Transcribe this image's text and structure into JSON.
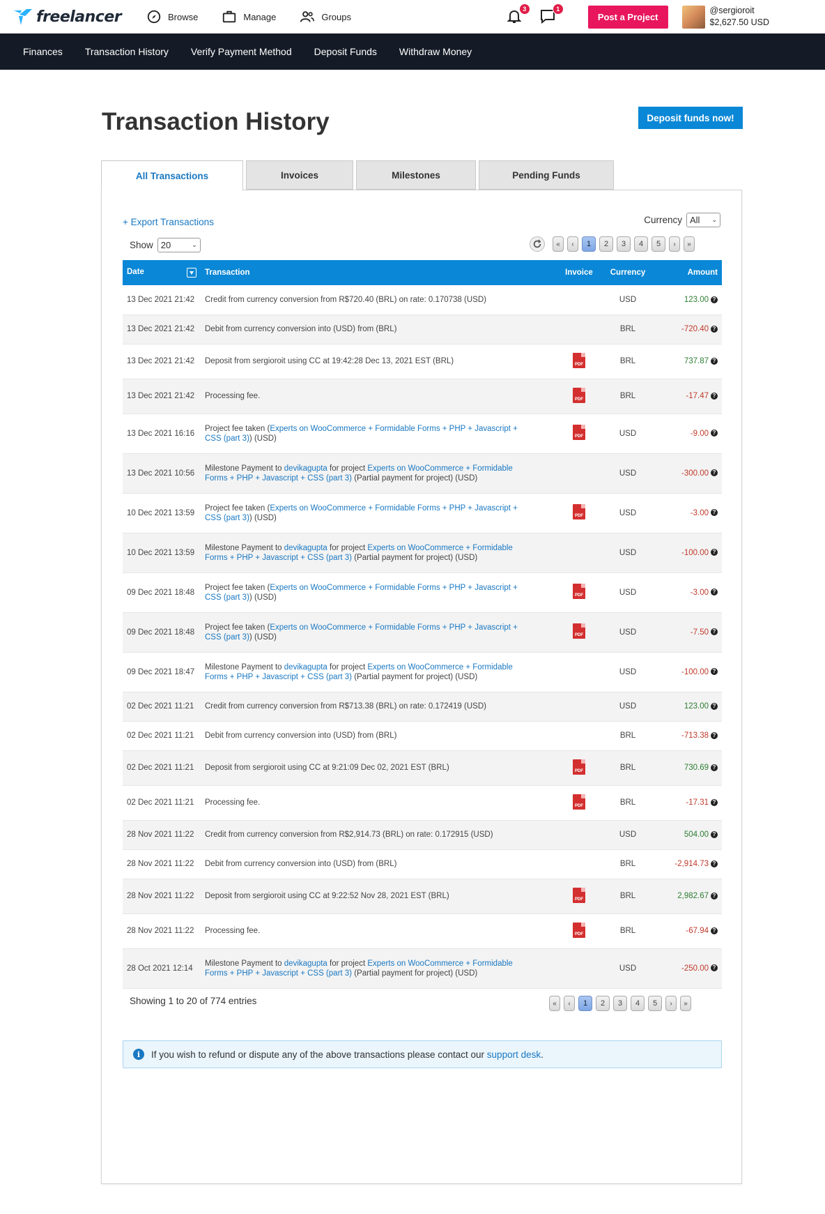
{
  "header": {
    "logo_text": "freelancer",
    "nav": [
      {
        "label": "Browse",
        "icon": "compass-icon"
      },
      {
        "label": "Manage",
        "icon": "briefcase-icon"
      },
      {
        "label": "Groups",
        "icon": "groups-icon"
      }
    ],
    "notifications_count": "3",
    "messages_count": "1",
    "post_project_label": "Post a Project",
    "username": "@sergioroit",
    "balance": "$2,627.50 USD"
  },
  "subnav": [
    "Finances",
    "Transaction History",
    "Verify Payment Method",
    "Deposit Funds",
    "Withdraw Money"
  ],
  "page": {
    "title": "Transaction History",
    "deposit_button": "Deposit funds now!",
    "tabs": [
      "All Transactions",
      "Invoices",
      "Milestones",
      "Pending Funds"
    ],
    "active_tab": 0
  },
  "controls": {
    "export_label": "+ Export Transactions",
    "currency_label": "Currency",
    "currency_value": "All",
    "show_label": "Show",
    "show_value": "20",
    "pages": [
      "«",
      "‹",
      "1",
      "2",
      "3",
      "4",
      "5",
      "›",
      "»"
    ],
    "current_page": "1"
  },
  "table": {
    "headers": [
      "Date",
      "Transaction",
      "Invoice",
      "Currency",
      "Amount"
    ],
    "rows": [
      {
        "date": "13 Dec 2021 21:42",
        "tx": [
          {
            "t": "Credit from currency conversion from R$720.40 (BRL) on rate: 0.170738 (USD)"
          }
        ],
        "pdf": false,
        "currency": "USD",
        "amount": "123.00",
        "sign": "pos"
      },
      {
        "date": "13 Dec 2021 21:42",
        "tx": [
          {
            "t": "Debit from currency conversion into (USD) from (BRL)"
          }
        ],
        "pdf": false,
        "currency": "BRL",
        "amount": "-720.40",
        "sign": "neg"
      },
      {
        "date": "13 Dec 2021 21:42",
        "tx": [
          {
            "t": "Deposit from sergioroit using CC at 19:42:28 Dec 13, 2021 EST (BRL)"
          }
        ],
        "pdf": true,
        "currency": "BRL",
        "amount": "737.87",
        "sign": "pos"
      },
      {
        "date": "13 Dec 2021 21:42",
        "tx": [
          {
            "t": "Processing fee."
          }
        ],
        "pdf": true,
        "currency": "BRL",
        "amount": "-17.47",
        "sign": "neg"
      },
      {
        "date": "13 Dec 2021 16:16",
        "tx": [
          {
            "t": "Project fee taken ("
          },
          {
            "t": "Experts on WooCommerce + Formidable Forms + PHP + Javascript + CSS (part 3)",
            "link": true
          },
          {
            "t": ") (USD)"
          }
        ],
        "pdf": true,
        "currency": "USD",
        "amount": "-9.00",
        "sign": "neg"
      },
      {
        "date": "13 Dec 2021 10:56",
        "tx": [
          {
            "t": "Milestone Payment to "
          },
          {
            "t": "devikagupta",
            "link": true
          },
          {
            "t": " for project "
          },
          {
            "t": "Experts on WooCommerce + Formidable Forms + PHP + Javascript + CSS (part 3)",
            "link": true
          },
          {
            "t": " (Partial payment for project) (USD)"
          }
        ],
        "pdf": false,
        "currency": "USD",
        "amount": "-300.00",
        "sign": "neg"
      },
      {
        "date": "10 Dec 2021 13:59",
        "tx": [
          {
            "t": "Project fee taken ("
          },
          {
            "t": "Experts on WooCommerce + Formidable Forms + PHP + Javascript + CSS (part 3)",
            "link": true
          },
          {
            "t": ") (USD)"
          }
        ],
        "pdf": true,
        "currency": "USD",
        "amount": "-3.00",
        "sign": "neg"
      },
      {
        "date": "10 Dec 2021 13:59",
        "tx": [
          {
            "t": "Milestone Payment to "
          },
          {
            "t": "devikagupta",
            "link": true
          },
          {
            "t": " for project "
          },
          {
            "t": "Experts on WooCommerce + Formidable Forms + PHP + Javascript + CSS (part 3)",
            "link": true
          },
          {
            "t": " (Partial payment for project) (USD)"
          }
        ],
        "pdf": false,
        "currency": "USD",
        "amount": "-100.00",
        "sign": "neg"
      },
      {
        "date": "09 Dec 2021 18:48",
        "tx": [
          {
            "t": "Project fee taken ("
          },
          {
            "t": "Experts on WooCommerce + Formidable Forms + PHP + Javascript + CSS (part 3)",
            "link": true
          },
          {
            "t": ") (USD)"
          }
        ],
        "pdf": true,
        "currency": "USD",
        "amount": "-3.00",
        "sign": "neg"
      },
      {
        "date": "09 Dec 2021 18:48",
        "tx": [
          {
            "t": "Project fee taken ("
          },
          {
            "t": "Experts on WooCommerce + Formidable Forms + PHP + Javascript + CSS (part 3)",
            "link": true
          },
          {
            "t": ") (USD)"
          }
        ],
        "pdf": true,
        "currency": "USD",
        "amount": "-7.50",
        "sign": "neg"
      },
      {
        "date": "09 Dec 2021 18:47",
        "tx": [
          {
            "t": "Milestone Payment to "
          },
          {
            "t": "devikagupta",
            "link": true
          },
          {
            "t": " for project "
          },
          {
            "t": "Experts on WooCommerce + Formidable Forms + PHP + Javascript + CSS (part 3)",
            "link": true
          },
          {
            "t": " (Partial payment for project) (USD)"
          }
        ],
        "pdf": false,
        "currency": "USD",
        "amount": "-100.00",
        "sign": "neg"
      },
      {
        "date": "02 Dec 2021 11:21",
        "tx": [
          {
            "t": "Credit from currency conversion from R$713.38 (BRL) on rate: 0.172419 (USD)"
          }
        ],
        "pdf": false,
        "currency": "USD",
        "amount": "123.00",
        "sign": "pos"
      },
      {
        "date": "02 Dec 2021 11:21",
        "tx": [
          {
            "t": "Debit from currency conversion into (USD) from (BRL)"
          }
        ],
        "pdf": false,
        "currency": "BRL",
        "amount": "-713.38",
        "sign": "neg"
      },
      {
        "date": "02 Dec 2021 11:21",
        "tx": [
          {
            "t": "Deposit from sergioroit using CC at 9:21:09 Dec 02, 2021 EST (BRL)"
          }
        ],
        "pdf": true,
        "currency": "BRL",
        "amount": "730.69",
        "sign": "pos"
      },
      {
        "date": "02 Dec 2021 11:21",
        "tx": [
          {
            "t": "Processing fee."
          }
        ],
        "pdf": true,
        "currency": "BRL",
        "amount": "-17.31",
        "sign": "neg"
      },
      {
        "date": "28 Nov 2021 11:22",
        "tx": [
          {
            "t": "Credit from currency conversion from R$2,914.73 (BRL) on rate: 0.172915 (USD)"
          }
        ],
        "pdf": false,
        "currency": "USD",
        "amount": "504.00",
        "sign": "pos"
      },
      {
        "date": "28 Nov 2021 11:22",
        "tx": [
          {
            "t": "Debit from currency conversion into (USD) from (BRL)"
          }
        ],
        "pdf": false,
        "currency": "BRL",
        "amount": "-2,914.73",
        "sign": "neg"
      },
      {
        "date": "28 Nov 2021 11:22",
        "tx": [
          {
            "t": "Deposit from sergioroit using CC at 9:22:52 Nov 28, 2021 EST (BRL)"
          }
        ],
        "pdf": true,
        "currency": "BRL",
        "amount": "2,982.67",
        "sign": "pos"
      },
      {
        "date": "28 Nov 2021 11:22",
        "tx": [
          {
            "t": "Processing fee."
          }
        ],
        "pdf": true,
        "currency": "BRL",
        "amount": "-67.94",
        "sign": "neg"
      },
      {
        "date": "28 Oct 2021 12:14",
        "tx": [
          {
            "t": "Milestone Payment to "
          },
          {
            "t": "devikagupta",
            "link": true
          },
          {
            "t": " for project "
          },
          {
            "t": "Experts on WooCommerce + Formidable Forms + PHP + Javascript + CSS (part 3)",
            "link": true
          },
          {
            "t": " (Partial payment for project) (USD)"
          }
        ],
        "pdf": false,
        "currency": "USD",
        "amount": "-250.00",
        "sign": "neg"
      }
    ]
  },
  "footer": {
    "showing": "Showing 1 to 20 of 774 entries",
    "info_text": "If you wish to refund or dispute any of the above transactions please contact our ",
    "info_link": "support desk",
    "info_end": "."
  },
  "colors": {
    "accent": "#0a87d6",
    "post_button": "#e8175d",
    "subnav_bg": "#151b26",
    "positive": "#2e7d32",
    "negative": "#c0392b"
  }
}
